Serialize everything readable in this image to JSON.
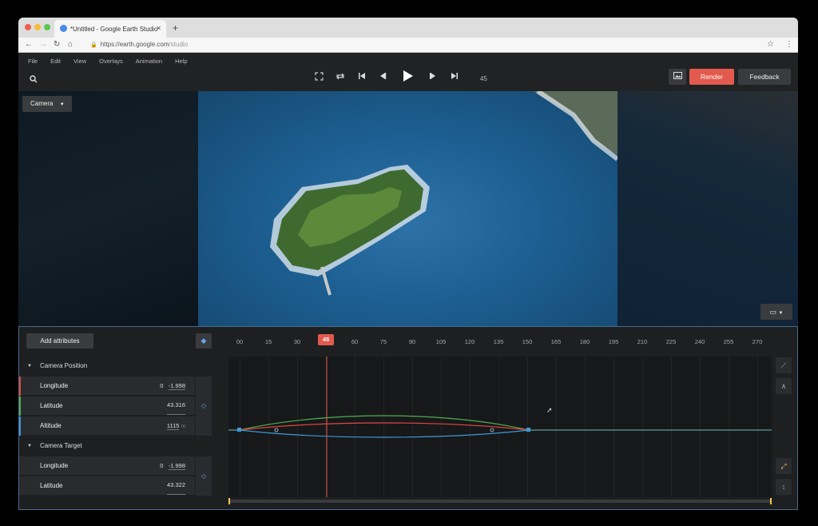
{
  "browser": {
    "tab_title": "*Untitled - Google Earth Studio",
    "new_tab": "+",
    "url_domain": "https://earth.google.com",
    "url_path": "/studio"
  },
  "menu": [
    "File",
    "Edit",
    "View",
    "Overlays",
    "Animation",
    "Help"
  ],
  "header": {
    "frame": "45",
    "render_label": "Render",
    "feedback_label": "Feedback"
  },
  "viewport": {
    "camera_label": "Camera"
  },
  "timeline": {
    "add_attributes_label": "Add attributes",
    "ticks": [
      "00",
      "15",
      "30",
      "45",
      "60",
      "75",
      "90",
      "105",
      "120",
      "135",
      "150",
      "165",
      "180",
      "195",
      "210",
      "225",
      "240",
      "255",
      "270"
    ],
    "current_frame": "45",
    "groups": [
      {
        "label": "Camera Position",
        "rows": [
          {
            "label": "Longitude",
            "offset": "0",
            "value": "-1.998"
          },
          {
            "label": "Latitude",
            "value": "43.316"
          },
          {
            "label": "Altitude",
            "value": "1115",
            "unit": "m"
          }
        ]
      },
      {
        "label": "Camera Target",
        "rows": [
          {
            "label": "Longitude",
            "offset": "0",
            "value": "-1.998"
          },
          {
            "label": "Latitude",
            "value": "43.322"
          }
        ]
      }
    ]
  },
  "colors": {
    "accent": "#e25a4d",
    "longitude": "#e0483f",
    "latitude": "#4caf50",
    "altitude": "#3b9ad9"
  }
}
